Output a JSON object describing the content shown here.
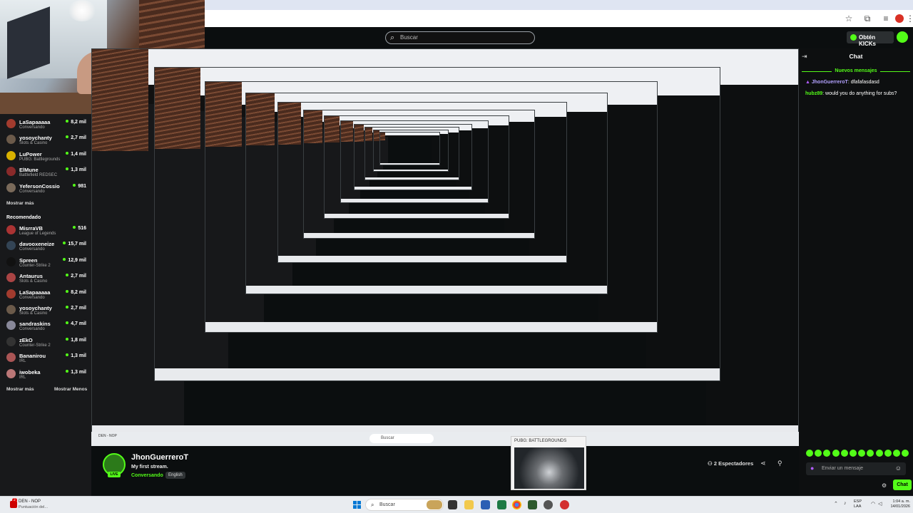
{
  "header": {
    "search_placeholder": "Buscar",
    "kicks_button": "Obtén KICKs"
  },
  "sidebar": {
    "following": [
      {
        "name": "LaSapaaaaa",
        "category": "Conversando",
        "viewers": "8,2 mil",
        "color": "#a23b2e"
      },
      {
        "name": "yosoychanty",
        "category": "Slots & Casino",
        "viewers": "2,7 mil",
        "color": "#6b5a4a"
      },
      {
        "name": "LuPower",
        "category": "PUBG: Battlegrounds",
        "viewers": "1,4 mil",
        "color": "#d9b100"
      },
      {
        "name": "ElMune",
        "category": "Battlefield REDSEC",
        "viewers": "1,3 mil",
        "color": "#8a2a2a"
      },
      {
        "name": "YefersonCossio",
        "category": "Conversando",
        "viewers": "981",
        "color": "#7a6a5a"
      }
    ],
    "show_more": "Mostrar más",
    "recommended_heading": "Recomendado",
    "recommended": [
      {
        "name": "MisrraVB",
        "category": "League of Legends",
        "viewers": "516",
        "color": "#a33"
      },
      {
        "name": "davooxeneize",
        "category": "Conversando",
        "viewers": "15,7 mil",
        "color": "#345"
      },
      {
        "name": "Spreen",
        "category": "Counter-Strike 2",
        "viewers": "12,9 mil",
        "color": "#111"
      },
      {
        "name": "Antaurus",
        "category": "Slots & Casino",
        "viewers": "2,7 mil",
        "color": "#a44"
      },
      {
        "name": "LaSapaaaaa",
        "category": "Conversando",
        "viewers": "8,2 mil",
        "color": "#a23b2e"
      },
      {
        "name": "yosoychanty",
        "category": "Slots & Casino",
        "viewers": "2,7 mil",
        "color": "#6b5a4a"
      },
      {
        "name": "sandraskins",
        "category": "Conversando",
        "viewers": "4,7 mil",
        "color": "#889"
      },
      {
        "name": "zEkO",
        "category": "Counter-Strike 2",
        "viewers": "1,8 mil",
        "color": "#333"
      },
      {
        "name": "Bananirou",
        "category": "IRL",
        "viewers": "1,3 mil",
        "color": "#a55"
      },
      {
        "name": "iwobeka",
        "category": "IRL",
        "viewers": "1,3 mil",
        "color": "#b77"
      }
    ],
    "show_more_2": "Mostrar más",
    "show_less": "Mostrar Menos"
  },
  "stream": {
    "streamer": "JhonGuerreroT",
    "live": "LIVE",
    "title": "My first stream.",
    "category": "Conversando",
    "language": "English",
    "viewers": "2 Espectadores"
  },
  "preview": {
    "title": "PUBG: BATTLEGROUNDS"
  },
  "inner_taskbar": {
    "app": "DEN - NOP",
    "search": "Buscar"
  },
  "chat": {
    "title": "Chat",
    "new_messages": "Nuevos mensajes",
    "messages": [
      {
        "user": "JhonGuerreroT",
        "text": ": dfafafasdasd"
      },
      {
        "user": "hubz89",
        "text": ": would you do anything for subs?"
      }
    ],
    "input_placeholder": "Enviar un mensaje",
    "send": "Chat"
  },
  "taskbar": {
    "app_title": "DEN - NOP",
    "app_subtitle": "Puntuación del...",
    "badge": "2",
    "search": "Buscar",
    "lang1": "ESP",
    "lang2": "LAA",
    "time": "1:04 a. m.",
    "date": "14/01/2026"
  }
}
